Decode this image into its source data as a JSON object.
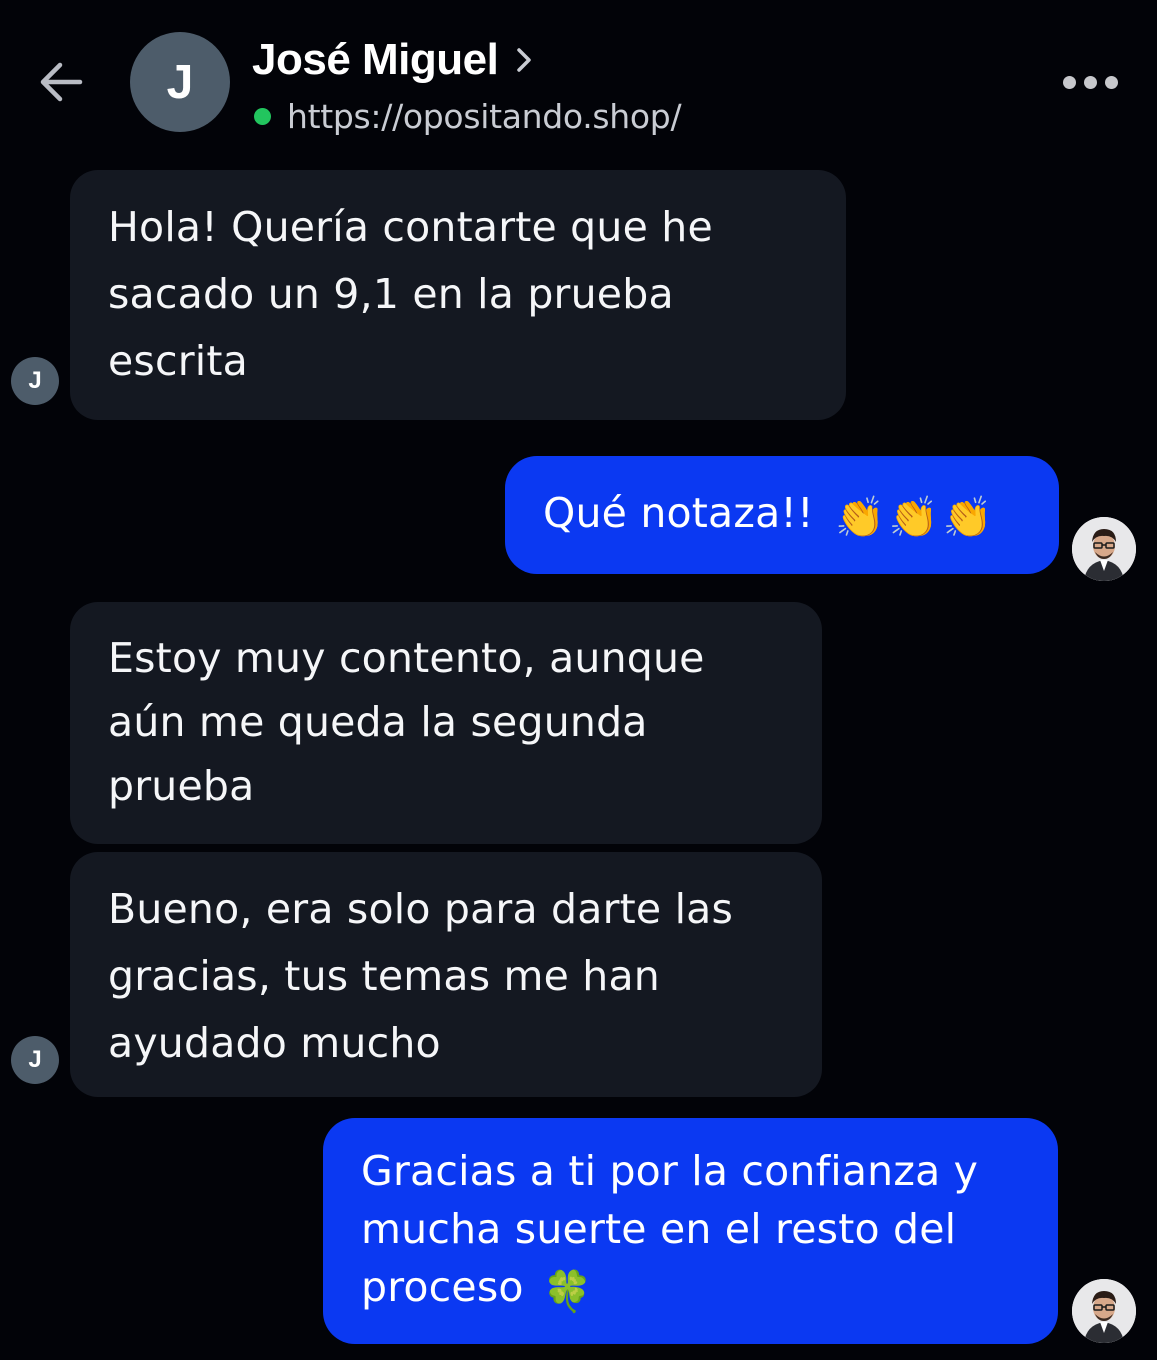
{
  "header": {
    "contact_initial": "J",
    "contact_name": "José Miguel",
    "url": "https://opositando.shop/",
    "status_color": "#22c55e",
    "icons": {
      "back": "arrow-left-icon",
      "chevron": "chevron-right-icon",
      "more": "more-horizontal-icon"
    }
  },
  "messages": [
    {
      "direction": "incoming",
      "text": "Hola! Quería contarte que he sacado un 9,1 en la prueba escrita",
      "avatar_initial": "J"
    },
    {
      "direction": "outgoing",
      "text": "Qué notaza!!",
      "emoji": "👏👏👏"
    },
    {
      "direction": "incoming",
      "text": "Estoy muy contento, aunque aún me queda la segunda prueba"
    },
    {
      "direction": "incoming",
      "text": "Bueno, era solo para darte las gracias, tus temas me han ayudado mucho",
      "avatar_initial": "J"
    },
    {
      "direction": "outgoing",
      "text": "Gracias a ti por la confianza y mucha suerte en el resto del proceso",
      "emoji": "🍀"
    }
  ],
  "colors": {
    "background": "#020308",
    "incoming_bubble": "#141821",
    "outgoing_bubble": "#0b39f2",
    "avatar": "#4d5c6a"
  }
}
